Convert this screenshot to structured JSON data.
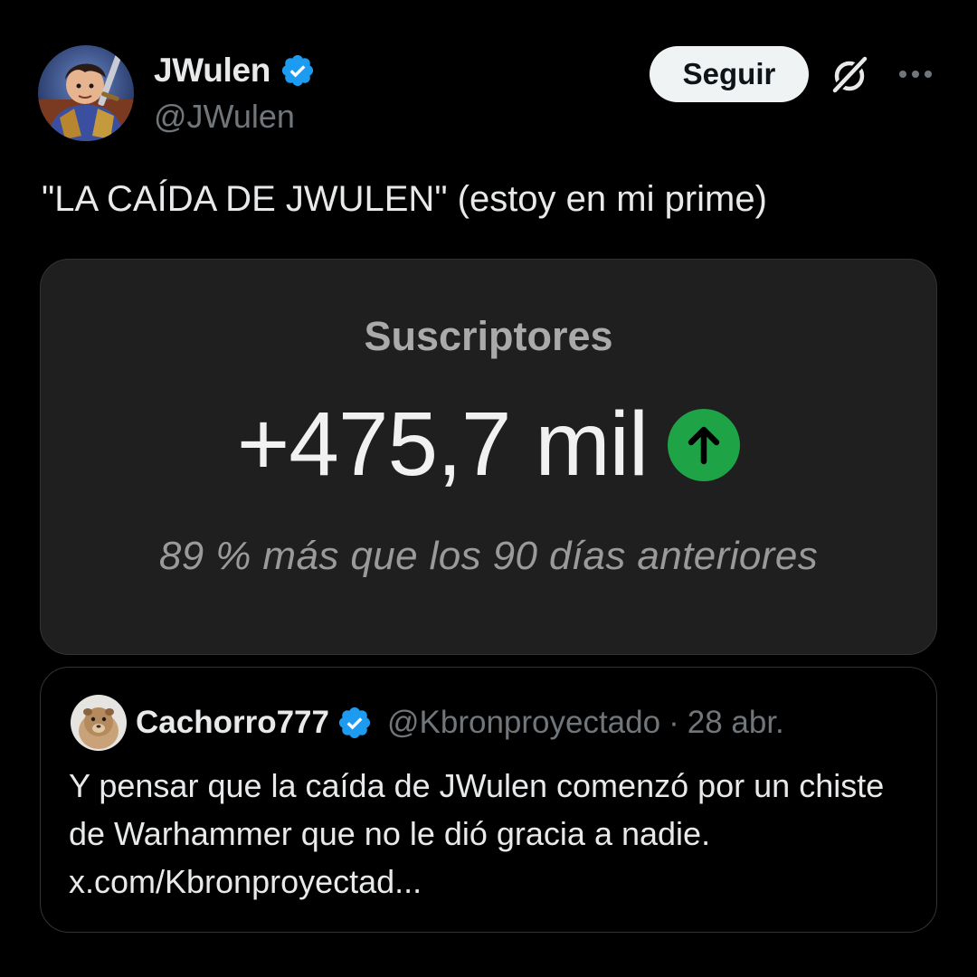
{
  "post": {
    "author": {
      "name": "JWulen",
      "handle": "@JWulen",
      "verified": true
    },
    "follow_label": "Seguir",
    "text": "\"LA CAÍDA DE JWULEN\" (estoy en mi prime)",
    "icons": {
      "verified": "verified-badge-icon",
      "grok": "grok-icon",
      "more": "more-options-icon"
    }
  },
  "media": {
    "label": "Suscriptores",
    "value": "+475,7 mil",
    "trend_icon": "arrow-up-circle-icon",
    "comparison": "89 % más que los 90 días anteriores"
  },
  "quote": {
    "author": {
      "name": "Cachorro777",
      "handle": "@Kbronproyectado",
      "verified": true
    },
    "separator": "·",
    "date": "28 abr.",
    "text": "Y pensar que la caída de JWulen comenzó por un chiste de Warhammer que no le dió gracia a nadie. x.com/Kbronproyectad..."
  },
  "colors": {
    "background": "#000000",
    "text_primary": "#e7e9ea",
    "text_secondary": "#71767b",
    "border": "#2f3336",
    "verified_blue": "#1d9bf0",
    "follow_button_bg": "#eff3f4",
    "media_bg": "#1f1f1f",
    "trend_green": "#1ea446"
  }
}
